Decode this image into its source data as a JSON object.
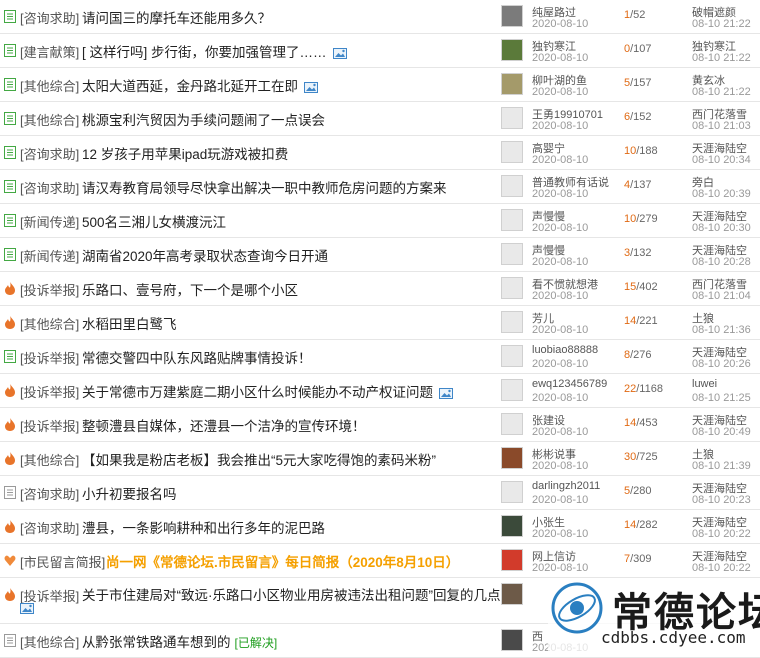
{
  "rows": [
    {
      "icon": "doc",
      "cat": "[咨询求助]",
      "title": "请问国三的摩托车还能用多久？",
      "img": false,
      "author": "纯屋路过",
      "pdate": "2020-08-10",
      "replies": "1",
      "views": "/52",
      "luser": "破帽遮颜",
      "ltime": "08-10 21:22",
      "av": "#7b7b7b"
    },
    {
      "icon": "doc",
      "cat": "[建言献策]",
      "title": "[ 这样行吗] 步行街，你要加强管理了……",
      "img": true,
      "author": "独钓寒江",
      "pdate": "2020-08-10",
      "replies": "0",
      "views": "/107",
      "luser": "独钓寒江",
      "ltime": "08-10 21:22",
      "av": "#5b7a3a"
    },
    {
      "icon": "doc",
      "cat": "[其他综合]",
      "title": "太阳大道西延，金丹路北延开工在即",
      "img": true,
      "author": "柳叶湖的鱼",
      "pdate": "2020-08-10",
      "replies": "5",
      "views": "/157",
      "luser": "黄玄冰",
      "ltime": "08-10 21:22",
      "av": "#a49a6a"
    },
    {
      "icon": "doc",
      "cat": "[其他综合]",
      "title": "桃源宝利汽贸因为手续问题闹了一点误会",
      "img": false,
      "author": "王勇19910701",
      "pdate": "2020-08-10",
      "replies": "6",
      "views": "/152",
      "luser": "西门花落雪",
      "ltime": "08-10 21:03",
      "av": "#e9e9e9"
    },
    {
      "icon": "doc",
      "cat": "[咨询求助]",
      "title": "12 岁孩子用苹果ipad玩游戏被扣费",
      "img": false,
      "author": "高婴宁",
      "pdate": "2020-08-10",
      "replies": "10",
      "views": "/188",
      "luser": "天涯海陆空",
      "ltime": "08-10 20:34",
      "av": "#e9e9e9"
    },
    {
      "icon": "doc",
      "cat": "[咨询求助]",
      "title": "请汉寿教育局领导尽快拿出解决一职中教师危房问题的方案来",
      "img": false,
      "author": "普通教师有话说",
      "pdate": "2020-08-10",
      "replies": "4",
      "views": "/137",
      "luser": "旁白",
      "ltime": "08-10 20:39",
      "av": "#e9e9e9"
    },
    {
      "icon": "doc",
      "cat": "[新闻传递]",
      "title": "500名三湘儿女横渡沅江",
      "img": false,
      "author": "声慢慢",
      "pdate": "2020-08-10",
      "replies": "10",
      "views": "/279",
      "luser": "天涯海陆空",
      "ltime": "08-10 20:30",
      "av": "#e9e9e9"
    },
    {
      "icon": "doc",
      "cat": "[新闻传递]",
      "title": "湖南省2020年高考录取状态查询今日开通",
      "img": false,
      "author": "声慢慢",
      "pdate": "2020-08-10",
      "replies": "3",
      "views": "/132",
      "luser": "天涯海陆空",
      "ltime": "08-10 20:28",
      "av": "#e9e9e9"
    },
    {
      "icon": "fire",
      "cat": "[投诉举报]",
      "title": "乐路口、壹号府，下一个是哪个小区",
      "img": false,
      "author": "看不惯就想港",
      "pdate": "2020-08-10",
      "replies": "15",
      "views": "/402",
      "luser": "西门花落雪",
      "ltime": "08-10 21:04",
      "av": "#e9e9e9"
    },
    {
      "icon": "fire",
      "cat": "[其他综合]",
      "title": "水稻田里白鹭飞",
      "img": false,
      "author": "芳儿",
      "pdate": "2020-08-10",
      "replies": "14",
      "views": "/221",
      "luser": "土狼",
      "ltime": "08-10 21:36",
      "av": "#e9e9e9"
    },
    {
      "icon": "doc",
      "cat": "[投诉举报]",
      "title": "常德交警四中队东风路贴牌事情投诉！",
      "img": false,
      "author": "luobiao88888",
      "pdate": "2020-08-10",
      "replies": "8",
      "views": "/276",
      "luser": "天涯海陆空",
      "ltime": "08-10 20:26",
      "av": "#e9e9e9"
    },
    {
      "icon": "fire",
      "cat": "[投诉举报]",
      "title": "关于常德市万建紫庭二期小区什么时候能办不动产权证问题",
      "img": true,
      "author": "ewq123456789",
      "pdate": "2020-08-10",
      "replies": "22",
      "views": "/1168",
      "luser": "luwei",
      "ltime": "08-10 21:25",
      "av": "#e9e9e9"
    },
    {
      "icon": "fire",
      "cat": "[投诉举报]",
      "title": "整顿澧县自媒体，还澧县一个洁净的宣传环境！",
      "img": false,
      "author": "张建设",
      "pdate": "2020-08-10",
      "replies": "14",
      "views": "/453",
      "luser": "天涯海陆空",
      "ltime": "08-10 20:49",
      "av": "#e9e9e9"
    },
    {
      "icon": "fire",
      "cat": "[其他综合]",
      "title": "【如果我是粉店老板】我会推出“5元大家吃得饱的素码米粉”",
      "img": false,
      "author": "彬彬说事",
      "pdate": "2020-08-10",
      "replies": "30",
      "views": "/725",
      "luser": "土狼",
      "ltime": "08-10 21:39",
      "av": "#8a4a2a"
    },
    {
      "icon": "docgray",
      "cat": "[咨询求助]",
      "title": "小升初要报名吗",
      "img": false,
      "author": "darlingzh2011",
      "pdate": "2020-08-10",
      "replies": "5",
      "views": "/280",
      "luser": "天涯海陆空",
      "ltime": "08-10 20:23",
      "av": "#e9e9e9"
    },
    {
      "icon": "fire",
      "cat": "[咨询求助]",
      "title": "澧县，一条影响耕种和出行多年的泥巴路",
      "img": false,
      "author": "小张生",
      "pdate": "2020-08-10",
      "replies": "14",
      "views": "/282",
      "luser": "天涯海陆空",
      "ltime": "08-10 20:22",
      "av": "#3b4a3a"
    },
    {
      "icon": "heart",
      "cat": "[市民留言简报]",
      "title": "尚一网《常德论坛.市民留言》每日简报（2020年8月10日）",
      "img": false,
      "bold": true,
      "author": "网上信访",
      "pdate": "2020-08-10",
      "replies": "7",
      "views": "/309",
      "luser": "天涯海陆空",
      "ltime": "08-10 20:22",
      "av": "#d23b2b"
    },
    {
      "icon": "fire",
      "cat": "[投诉举报]",
      "title": "关于市住建局对“致远·乐路口小区物业用房被违法出租问题”回复的几点…",
      "img": true,
      "tall": true,
      "author": "",
      "pdate": "",
      "replies": "",
      "views": "",
      "luser": "",
      "ltime": "",
      "av": "#6d5a48"
    },
    {
      "icon": "docgray",
      "cat": "[其他综合]",
      "title": "从黔张常铁路通车想到的",
      "img": false,
      "tag": "[已解决]",
      "author": "西",
      "pdate": "2020-08-10",
      "replies": "",
      "views": "",
      "luser": "",
      "ltime": "",
      "av": "#4a4a4a"
    }
  ],
  "watermark": {
    "name": "常德论坛",
    "url": "cdbbs.cdyee.com"
  },
  "colors": {
    "accent": "#e06a14",
    "green_tag": "#1d9d1d",
    "bold_title": "#f5a000"
  }
}
